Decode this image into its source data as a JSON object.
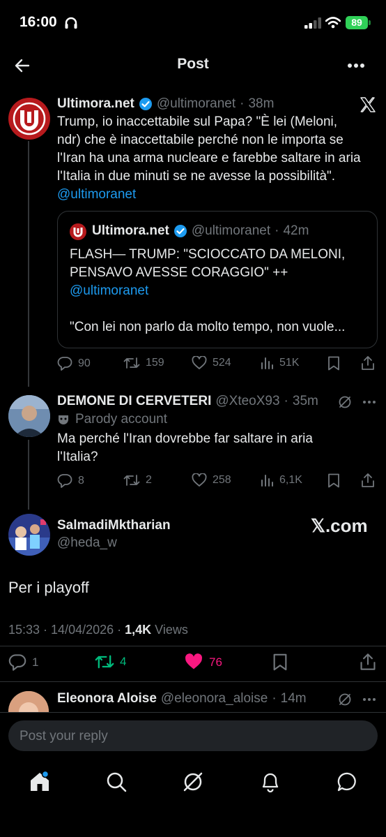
{
  "status_bar": {
    "time": "16:00",
    "battery": "89"
  },
  "header": {
    "title": "Post"
  },
  "tweet1": {
    "name": "Ultimora.net",
    "handle": "@ultimoranet",
    "time": "38m",
    "text_lines": [
      "Trump, io inaccettabile sul Papa? \"È lei (Meloni,",
      "ndr) che è inaccettabile perché non le importa se",
      "l'Iran ha una arma nucleare e farebbe saltare in aria",
      "l'Italia in due minuti se ne avesse la possibilità\"."
    ],
    "mention": "@ultimoranet",
    "quote": {
      "name": "Ultimora.net",
      "handle": "@ultimoranet",
      "time": "42m",
      "text_lines": [
        "FLASH— TRUMP: \"SCIOCCATO DA MELONI,",
        "PENSAVO AVESSE CORAGGIO\" ++"
      ],
      "mention": "@ultimoranet",
      "excerpt": "\"Con lei non parlo da molto tempo, non vuole..."
    },
    "stats": {
      "replies": "90",
      "reposts": "159",
      "likes": "524",
      "views": "51K"
    }
  },
  "tweet2": {
    "name": "DEMONE DI CERVETERI",
    "handle": "@XteoX93",
    "time": "35m",
    "parody_label": "Parody account",
    "text_lines": [
      "Ma perché l'Iran dovrebbe far saltare in aria",
      "l'Italia?"
    ],
    "stats": {
      "replies": "8",
      "reposts": "2",
      "likes": "258",
      "views": "6,1K"
    }
  },
  "main_post": {
    "name": "SalmadiMktharian",
    "handle": "@heda_w",
    "brand_watermark": "𝕏.com",
    "text": "Per i playoff",
    "timestamp": "15:33 · 14/04/2026 · ",
    "views_count": "1,4K",
    "views_label": " Views",
    "stats": {
      "replies": "1",
      "reposts": "4",
      "likes": "76"
    },
    "colors": {
      "repost_active": "#00ba7c",
      "like_active": "#f91880"
    }
  },
  "next_reply": {
    "name": "Eleonora Aloise",
    "handle": "@eleonora_aloise",
    "time": "14m"
  },
  "reply_input": {
    "placeholder": "Post your reply"
  },
  "bottom_nav": [
    "home-icon",
    "search-icon",
    "grok-icon",
    "notifications-icon",
    "messages-icon"
  ]
}
